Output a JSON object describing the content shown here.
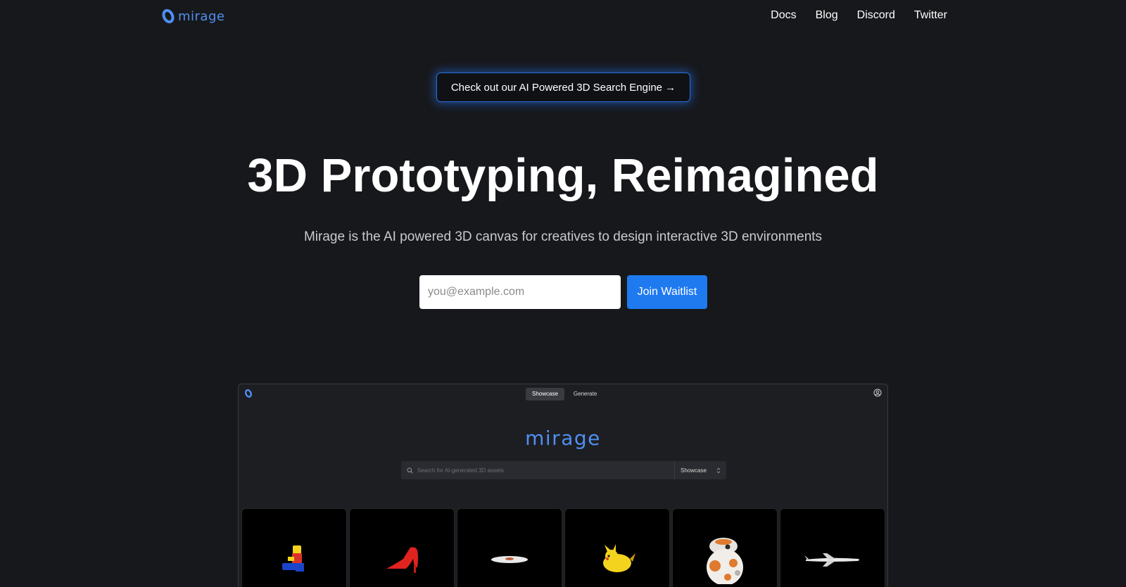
{
  "brand": {
    "name": "mirage",
    "accent": "#4f8ff2"
  },
  "nav": {
    "links": [
      "Docs",
      "Blog",
      "Discord",
      "Twitter"
    ]
  },
  "announcement": {
    "text": "Check out our AI Powered 3D Search Engine →"
  },
  "hero": {
    "title": "3D Prototyping, Reimagined",
    "subtitle": "Mirage is the AI powered 3D canvas for creatives to design interactive 3D environments"
  },
  "waitlist": {
    "placeholder": "you@example.com",
    "button_label": "Join Waitlist",
    "button_color": "#1f7af0"
  },
  "preview": {
    "tabs": [
      {
        "label": "Showcase",
        "active": true
      },
      {
        "label": "Generate",
        "active": false
      }
    ],
    "brand": "mirage",
    "search": {
      "placeholder": "Search for AI-generated 3D assets",
      "select_value": "Showcase"
    },
    "assets": [
      "lego-figure",
      "red-high-heel",
      "white-disc",
      "yellow-pikachu",
      "bb8-droid",
      "white-airplane"
    ]
  }
}
